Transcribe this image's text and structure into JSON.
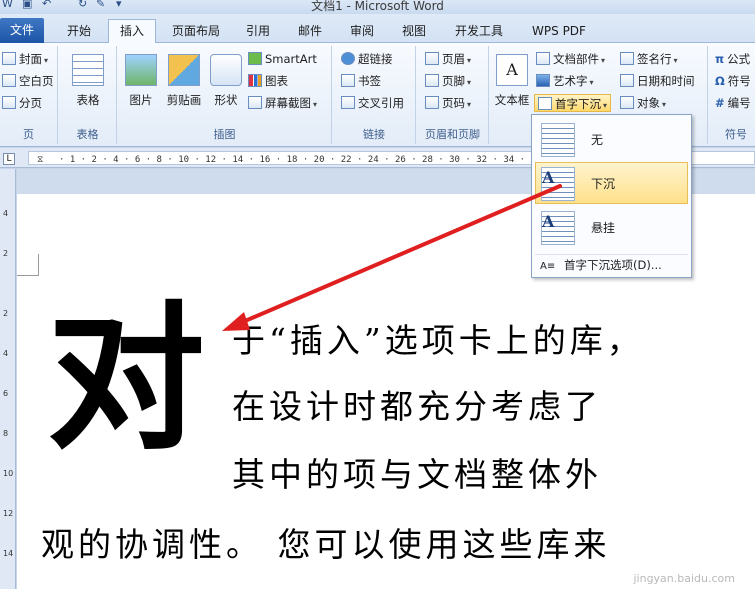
{
  "titlebar": {
    "title": "文档1 - Microsoft Word"
  },
  "tabs": [
    {
      "label": "文件"
    },
    {
      "label": "开始"
    },
    {
      "label": "插入"
    },
    {
      "label": "页面布局"
    },
    {
      "label": "引用"
    },
    {
      "label": "邮件"
    },
    {
      "label": "审阅"
    },
    {
      "label": "视图"
    },
    {
      "label": "开发工具"
    },
    {
      "label": "WPS PDF"
    }
  ],
  "ribbon": {
    "pages": {
      "cover": "封面",
      "blank": "空白页",
      "break": "分页",
      "group": "页"
    },
    "table": {
      "label": "表格",
      "group": "表格"
    },
    "illustrations": {
      "picture": "图片",
      "clipart": "剪贴画",
      "shapes": "形状",
      "smartart": "SmartArt",
      "chart": "图表",
      "screenshot": "屏幕截图",
      "group": "插图"
    },
    "links": {
      "hyperlink": "超链接",
      "bookmark": "书签",
      "crossref": "交叉引用",
      "group": "链接"
    },
    "headerfooter": {
      "header": "页眉",
      "footer": "页脚",
      "pagenum": "页码",
      "group": "页眉和页脚"
    },
    "text": {
      "textbox": "文本框",
      "docparts": "文档部件",
      "wordart": "艺术字",
      "dropcap": "首字下沉",
      "signature": "签名行",
      "datetime": "日期和时间",
      "object": "对象"
    },
    "symbols": {
      "equation": "公式",
      "symbol": "符号",
      "number": "编号",
      "group": "符号"
    }
  },
  "dropdown": {
    "items": [
      {
        "label": "无"
      },
      {
        "label": "下沉"
      },
      {
        "label": "悬挂"
      }
    ],
    "options": "首字下沉选项(D)..."
  },
  "document": {
    "dropcap": "对",
    "lines": [
      "于“插入”选项卡上的库，",
      "在设计时都充分考虑了",
      "其中的项与文档整体外",
      "观的协调性。 您可以使用这些库来"
    ]
  },
  "watermark": "jingyan.baidu.com",
  "colors": {
    "file_tab": "#2a5fae",
    "highlight": "#ffe08a",
    "arrow": "#e02020"
  }
}
